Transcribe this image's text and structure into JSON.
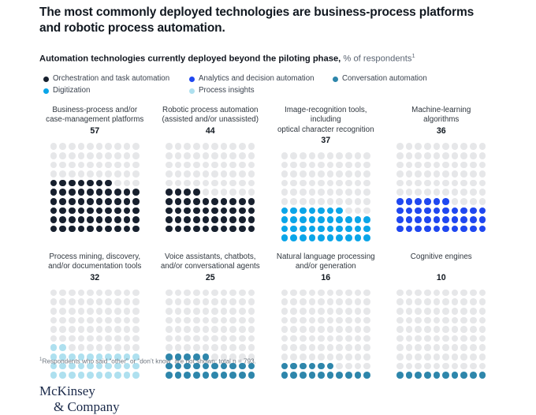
{
  "headline": "The most commonly deployed technologies are business-process platforms and robotic process automation.",
  "subhead": {
    "bold": "Automation technologies currently deployed beyond the piloting phase,",
    "light": "% of respondents",
    "footnote_marker": "1"
  },
  "legend": {
    "items": [
      {
        "label": "Orchestration and task automation",
        "color": "#17202e",
        "row": 0,
        "col": 0
      },
      {
        "label": "Analytics and decision automation",
        "color": "#1f47f0",
        "row": 0,
        "col": 1
      },
      {
        "label": "Conversation automation",
        "color": "#2e86ab",
        "row": 0,
        "col": 2
      },
      {
        "label": "Digitization",
        "color": "#0aa5e8",
        "row": 1,
        "col": 0
      },
      {
        "label": "Process insights",
        "color": "#aee0ef",
        "row": 1,
        "col": 1
      }
    ]
  },
  "colors": {
    "empty_dot": "#e6e7e9",
    "orchestration": "#17202e",
    "analytics": "#1f47f0",
    "conversation": "#2e86ab",
    "digitization": "#0aa5e8",
    "process_insights": "#aee0ef",
    "logo": "#1b2a4a"
  },
  "chart_data": {
    "type": "bar",
    "chart_style": "waffle-dot-grid",
    "title": "The most commonly deployed technologies are business-process platforms and robotic process automation.",
    "subtitle": "Automation technologies currently deployed beyond the piloting phase, % of respondents",
    "xlabel": "",
    "ylabel": "% of respondents",
    "ylim": [
      0,
      100
    ],
    "grid": false,
    "legend_position": "top",
    "grid_columns": 10,
    "grid_rows": 10,
    "fill_direction": "bottom-up",
    "categories": [
      "Business-process and/or case-management platforms",
      "Robotic process automation (assisted and/or unassisted)",
      "Image-recognition tools, including optical character recognition",
      "Machine-learning algorithms",
      "Process mining, discovery, and/or documentation tools",
      "Voice assistants, chatbots, and/or conversational agents",
      "Natural language processing and/or generation",
      "Cognitive engines"
    ],
    "values": [
      57,
      44,
      37,
      36,
      32,
      25,
      16,
      10
    ],
    "series": [
      {
        "name": "Orchestration and task automation",
        "color": "#17202e",
        "categories": [
          "Business-process and/or case-management platforms",
          "Robotic process automation (assisted and/or unassisted)"
        ],
        "values": [
          57,
          44
        ]
      },
      {
        "name": "Digitization",
        "color": "#0aa5e8",
        "categories": [
          "Image-recognition tools, including optical character recognition"
        ],
        "values": [
          37
        ]
      },
      {
        "name": "Analytics and decision automation",
        "color": "#1f47f0",
        "categories": [
          "Machine-learning algorithms"
        ],
        "values": [
          36
        ]
      },
      {
        "name": "Process insights",
        "color": "#aee0ef",
        "categories": [
          "Process mining, discovery, and/or documentation tools"
        ],
        "values": [
          32
        ]
      },
      {
        "name": "Conversation automation",
        "color": "#2e86ab",
        "categories": [
          "Voice assistants, chatbots, and/or conversational agents",
          "Natural language processing and/or generation",
          "Cognitive engines"
        ],
        "values": [
          25,
          16,
          10
        ]
      }
    ],
    "annotations": [
      "Respondents who said “other” or “don’t know” are not shown; total n = 793."
    ]
  },
  "panels": [
    {
      "title_line1": "Business-process and/or",
      "title_line2": "case-management platforms",
      "value": "57",
      "value_num": 57,
      "color": "#17202e",
      "series": "Orchestration and task automation"
    },
    {
      "title_line1": "Robotic process automation",
      "title_line2": "(assisted and/or unassisted)",
      "value": "44",
      "value_num": 44,
      "color": "#17202e",
      "series": "Orchestration and task automation"
    },
    {
      "title_line1": "Image-recognition tools, including",
      "title_line2": "optical character recognition",
      "value": "37",
      "value_num": 37,
      "color": "#0aa5e8",
      "series": "Digitization"
    },
    {
      "title_line1": "Machine-learning",
      "title_line2": "algorithms",
      "value": "36",
      "value_num": 36,
      "color": "#1f47f0",
      "series": "Analytics and decision automation"
    },
    {
      "title_line1": "Process mining, discovery,",
      "title_line2": "and/or documentation tools",
      "value": "32",
      "value_num": 32,
      "color": "#aee0ef",
      "series": "Process insights"
    },
    {
      "title_line1": "Voice assistants, chatbots,",
      "title_line2": "and/or conversational agents",
      "value": "25",
      "value_num": 25,
      "color": "#2e86ab",
      "series": "Conversation automation"
    },
    {
      "title_line1": "Natural language processing",
      "title_line2": "and/or generation",
      "value": "16",
      "value_num": 16,
      "color": "#2e86ab",
      "series": "Conversation automation"
    },
    {
      "title_line1": "Cognitive engines",
      "title_line2": "",
      "value": "10",
      "value_num": 10,
      "color": "#2e86ab",
      "series": "Conversation automation"
    }
  ],
  "footnote": {
    "marker": "1",
    "text": "Respondents who said “other” or “don’t know” are not shown; total n = 793."
  },
  "logo": {
    "line1": "McKinsey",
    "line2": "& Company"
  }
}
